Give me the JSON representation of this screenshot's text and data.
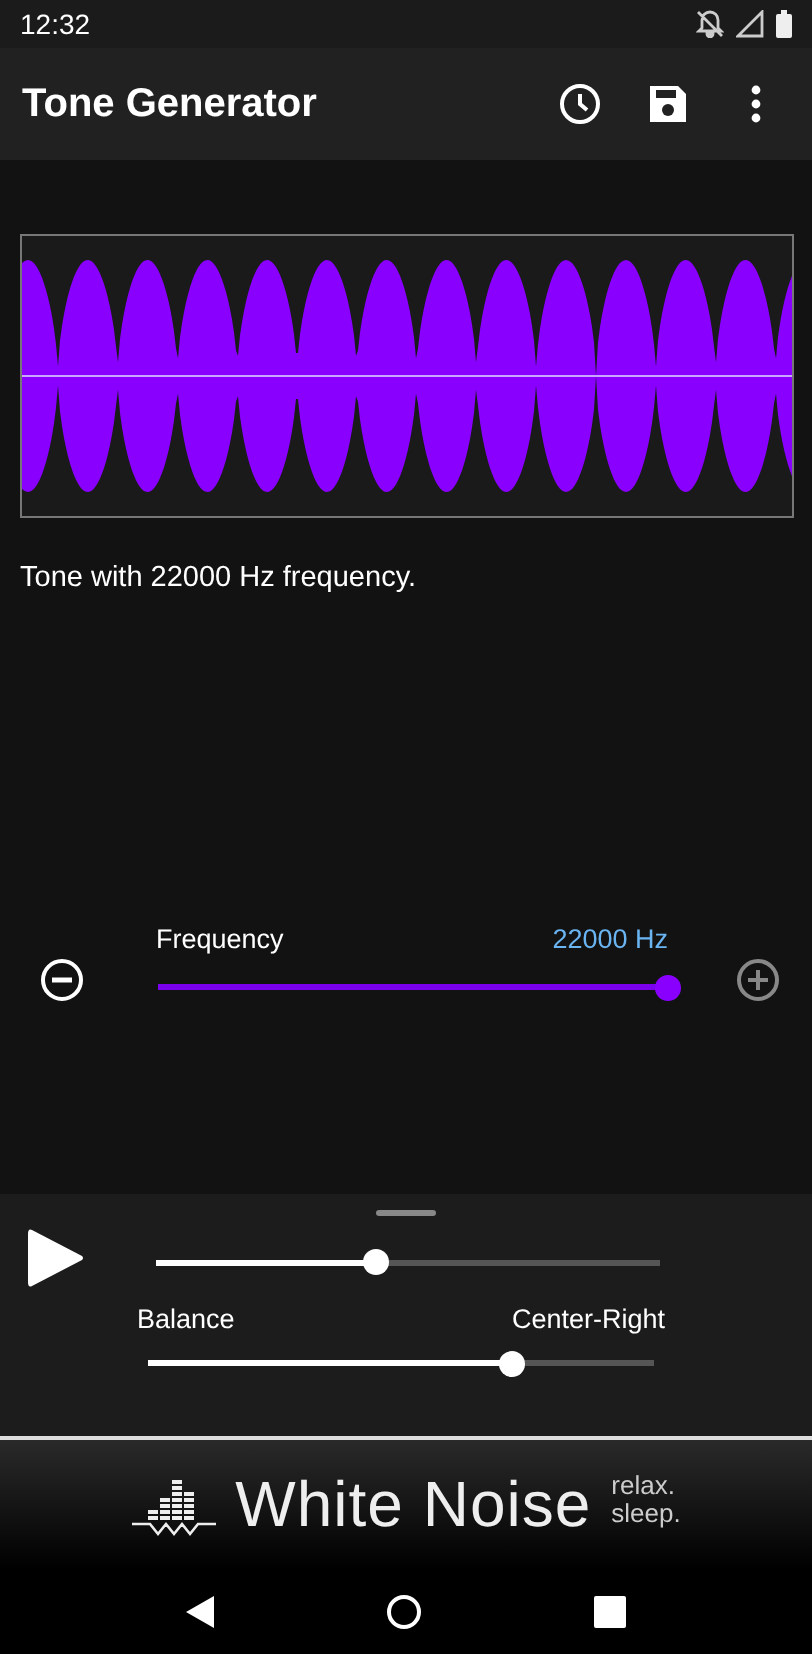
{
  "status_bar": {
    "time": "12:32"
  },
  "app_bar": {
    "title": "Tone Generator"
  },
  "description": "Tone with 22000 Hz frequency.",
  "frequency": {
    "label": "Frequency",
    "reading": "22000 Hz",
    "level": 1
  },
  "player": {
    "playing": false
  },
  "volume": {
    "level": 0.44
  },
  "balance": {
    "label": "Balance",
    "reading": "Center-Right",
    "level": 0.72
  },
  "ad": {
    "title": "White Noise",
    "tagline": [
      "relax.",
      "sleep."
    ]
  }
}
